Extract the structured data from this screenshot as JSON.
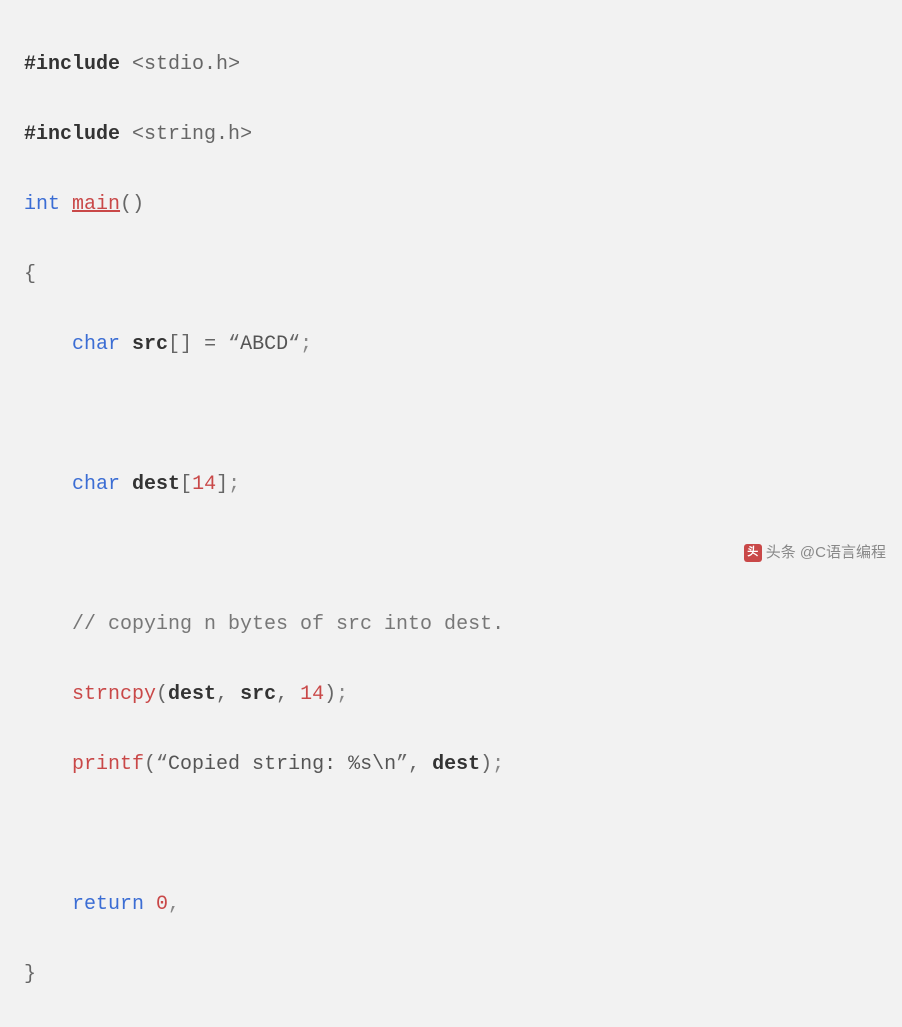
{
  "code": {
    "inc1_directive": "#include",
    "inc1_header": "stdio.h",
    "inc2_directive": "#include",
    "inc2_header": "string.h",
    "kw_int": "int",
    "fn_main": "main",
    "paren_open": "(",
    "paren_close": ")",
    "brace_open": "{",
    "kw_char1": "char",
    "var_src": "src",
    "brackets_empty": "[]",
    "eq": " = ",
    "quote_open1": "“",
    "str_abcd": "ABCD",
    "quote_close1": "“",
    "semi": ";",
    "kw_char2": "char",
    "var_dest": "dest",
    "bracket_open": "[",
    "num_14a": "14",
    "bracket_close": "]",
    "comment_line": "// copying n bytes of src into dest.",
    "fn_strncpy": "strncpy",
    "arg_dest": "dest",
    "comma": ", ",
    "arg_src": "src",
    "num_14b": "14",
    "fn_printf": "printf",
    "quote_open2": "“",
    "str_copied": "Copied string: %s\\n",
    "quote_close2": "”",
    "arg_dest2": "dest",
    "kw_return": "return",
    "num_0": "0",
    "comma_end": ",",
    "brace_close": "}"
  },
  "watermark": {
    "text": "头条 @C语言编程"
  }
}
